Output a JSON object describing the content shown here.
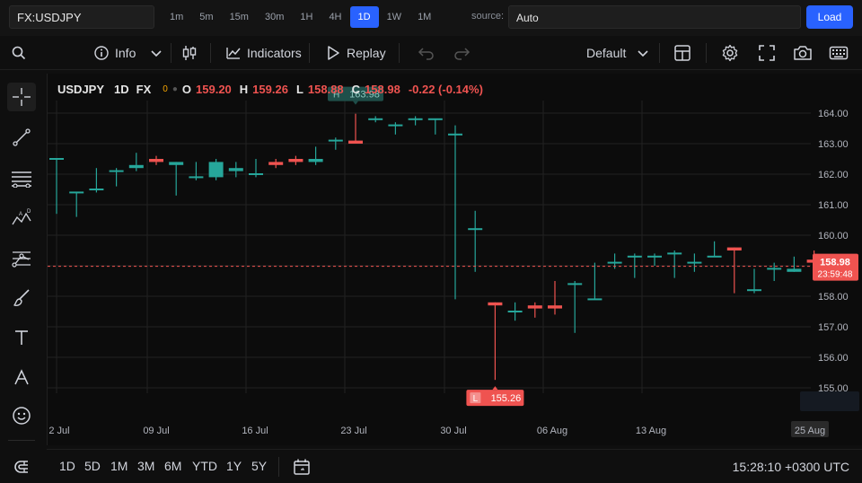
{
  "topbar": {
    "symbol": "FX:USDJPY",
    "timeframes": [
      "1m",
      "5m",
      "15m",
      "30m",
      "1H",
      "4H",
      "1D",
      "1W",
      "1M"
    ],
    "active_timeframe": "1D",
    "source_label": "source:",
    "source_value": "Auto",
    "load_label": "Load"
  },
  "toolbar": {
    "info_label": "Info",
    "indicators_label": "Indicators",
    "replay_label": "Replay",
    "layout_label": "Default"
  },
  "legend": {
    "symbol": "USDJPY",
    "interval": "1D",
    "exchange": "FX",
    "status_dot": "0",
    "o_label": "O",
    "o_value": "159.20",
    "h_label": "H",
    "h_value": "159.26",
    "l_label": "L",
    "l_value": "158.88",
    "c_label": "C",
    "c_value": "158.98",
    "change": "-0.22 (-0.14%)"
  },
  "chart_data": {
    "type": "candlestick",
    "ylim": [
      154.5,
      164.6
    ],
    "y_ticks": [
      "164.00",
      "163.00",
      "162.00",
      "161.00",
      "160.00",
      "159.00",
      "158.00",
      "157.00",
      "156.00",
      "155.00"
    ],
    "x_ticks": [
      "2 Jul",
      "09 Jul",
      "16 Jul",
      "23 Jul",
      "30 Jul",
      "06 Aug",
      "13 Aug",
      "25 Aug"
    ],
    "up_color": "#26a69a",
    "down_color": "#ef5350",
    "candles": [
      {
        "o": 162.5,
        "h": 162.5,
        "l": 160.7,
        "c": 162.5
      },
      {
        "o": 161.4,
        "h": 161.4,
        "l": 160.6,
        "c": 161.4
      },
      {
        "o": 161.5,
        "h": 162.2,
        "l": 161.4,
        "c": 161.5
      },
      {
        "o": 162.1,
        "h": 162.2,
        "l": 161.6,
        "c": 162.1
      },
      {
        "o": 162.2,
        "h": 162.7,
        "l": 162.1,
        "c": 162.3
      },
      {
        "o": 162.5,
        "h": 162.6,
        "l": 162.3,
        "c": 162.4
      },
      {
        "o": 162.3,
        "h": 162.4,
        "l": 161.3,
        "c": 162.4
      },
      {
        "o": 161.9,
        "h": 162.4,
        "l": 161.8,
        "c": 161.9
      },
      {
        "o": 161.9,
        "h": 162.5,
        "l": 161.8,
        "c": 162.4
      },
      {
        "o": 162.1,
        "h": 162.4,
        "l": 161.9,
        "c": 162.2
      },
      {
        "o": 162.0,
        "h": 162.5,
        "l": 161.9,
        "c": 162.0
      },
      {
        "o": 162.4,
        "h": 162.5,
        "l": 162.2,
        "c": 162.3
      },
      {
        "o": 162.5,
        "h": 162.6,
        "l": 162.3,
        "c": 162.4
      },
      {
        "o": 162.4,
        "h": 162.9,
        "l": 162.3,
        "c": 162.5
      },
      {
        "o": 163.1,
        "h": 163.2,
        "l": 162.8,
        "c": 163.1
      },
      {
        "o": 163.1,
        "h": 163.98,
        "l": 163.0,
        "c": 163.0
      },
      {
        "o": 163.8,
        "h": 163.9,
        "l": 163.7,
        "c": 163.8
      },
      {
        "o": 163.6,
        "h": 163.7,
        "l": 163.3,
        "c": 163.6
      },
      {
        "o": 163.8,
        "h": 163.9,
        "l": 163.6,
        "c": 163.8
      },
      {
        "o": 163.8,
        "h": 163.8,
        "l": 163.3,
        "c": 163.8
      },
      {
        "o": 163.3,
        "h": 163.6,
        "l": 157.9,
        "c": 163.3
      },
      {
        "o": 160.2,
        "h": 160.8,
        "l": 158.8,
        "c": 160.2
      },
      {
        "o": 157.8,
        "h": 157.8,
        "l": 155.26,
        "c": 157.7
      },
      {
        "o": 157.5,
        "h": 157.8,
        "l": 157.2,
        "c": 157.5
      },
      {
        "o": 157.7,
        "h": 157.8,
        "l": 157.3,
        "c": 157.6
      },
      {
        "o": 157.7,
        "h": 158.5,
        "l": 157.4,
        "c": 157.6
      },
      {
        "o": 158.4,
        "h": 158.5,
        "l": 156.8,
        "c": 158.4
      },
      {
        "o": 157.9,
        "h": 159.1,
        "l": 157.9,
        "c": 157.9
      },
      {
        "o": 159.1,
        "h": 159.4,
        "l": 158.9,
        "c": 159.1
      },
      {
        "o": 159.3,
        "h": 159.4,
        "l": 158.6,
        "c": 159.3
      },
      {
        "o": 159.3,
        "h": 159.4,
        "l": 159.0,
        "c": 159.3
      },
      {
        "o": 159.4,
        "h": 159.5,
        "l": 158.6,
        "c": 159.4
      },
      {
        "o": 159.1,
        "h": 159.4,
        "l": 158.8,
        "c": 159.1
      },
      {
        "o": 159.3,
        "h": 159.8,
        "l": 159.3,
        "c": 159.3
      },
      {
        "o": 159.6,
        "h": 159.6,
        "l": 158.1,
        "c": 159.5
      },
      {
        "o": 158.2,
        "h": 158.9,
        "l": 158.1,
        "c": 158.2
      },
      {
        "o": 158.9,
        "h": 159.1,
        "l": 158.5,
        "c": 158.9
      },
      {
        "o": 158.8,
        "h": 159.3,
        "l": 158.8,
        "c": 158.9
      },
      {
        "o": 159.2,
        "h": 159.5,
        "l": 158.9,
        "c": 159.1
      }
    ],
    "high_marker": {
      "label": "H",
      "value": "163.98"
    },
    "low_marker": {
      "label": "L",
      "value": "155.26"
    },
    "last_price": {
      "value": 158.98,
      "label": "158.98",
      "countdown": "23:59:48"
    }
  },
  "bottombar": {
    "ranges": [
      "1D",
      "5D",
      "1M",
      "3M",
      "6M",
      "YTD",
      "1Y",
      "5Y"
    ],
    "clock": "15:28:10 +0300 UTC"
  },
  "colors": {
    "accent": "#2962ff",
    "up": "#26a69a",
    "down": "#ef5350"
  }
}
